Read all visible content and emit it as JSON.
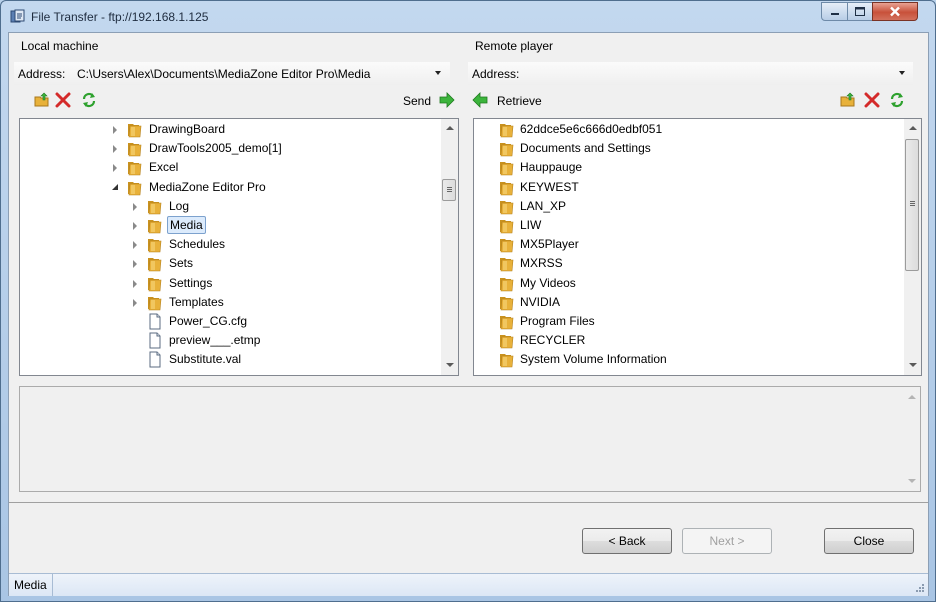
{
  "window": {
    "title": "File Transfer - ftp://192.168.1.125"
  },
  "local": {
    "heading": "Local machine",
    "address_label": "Address:",
    "address_value": "C:\\Users\\Alex\\Documents\\MediaZone Editor Pro\\Media",
    "send_label": "Send",
    "tree": [
      {
        "label": "DrawingBoard",
        "type": "folder",
        "indent": 0,
        "expander": "closed"
      },
      {
        "label": "DrawTools2005_demo[1]",
        "type": "folder",
        "indent": 0,
        "expander": "closed"
      },
      {
        "label": "Excel",
        "type": "folder",
        "indent": 0,
        "expander": "closed"
      },
      {
        "label": "MediaZone Editor Pro",
        "type": "folder",
        "indent": 0,
        "expander": "open"
      },
      {
        "label": "Log",
        "type": "folder",
        "indent": 1,
        "expander": "closed"
      },
      {
        "label": "Media",
        "type": "folder",
        "indent": 1,
        "expander": "closed",
        "selected": true
      },
      {
        "label": "Schedules",
        "type": "folder",
        "indent": 1,
        "expander": "closed"
      },
      {
        "label": "Sets",
        "type": "folder",
        "indent": 1,
        "expander": "closed"
      },
      {
        "label": "Settings",
        "type": "folder",
        "indent": 1,
        "expander": "closed"
      },
      {
        "label": "Templates",
        "type": "folder",
        "indent": 1,
        "expander": "closed"
      },
      {
        "label": "Power_CG.cfg",
        "type": "file",
        "indent": 1,
        "expander": "none"
      },
      {
        "label": "preview___.etmp",
        "type": "file",
        "indent": 1,
        "expander": "none"
      },
      {
        "label": "Substitute.val",
        "type": "file",
        "indent": 1,
        "expander": "none"
      }
    ]
  },
  "remote": {
    "heading": "Remote player",
    "address_label": "Address:",
    "address_value": "",
    "retrieve_label": "Retrieve",
    "tree": [
      {
        "label": "62ddce5e6c666d0edbf051"
      },
      {
        "label": "Documents and Settings"
      },
      {
        "label": "Hauppauge"
      },
      {
        "label": "KEYWEST"
      },
      {
        "label": "LAN_XP"
      },
      {
        "label": "LIW"
      },
      {
        "label": "MX5Player"
      },
      {
        "label": "MXRSS"
      },
      {
        "label": "My Videos"
      },
      {
        "label": "NVIDIA"
      },
      {
        "label": "Program Files"
      },
      {
        "label": "RECYCLER"
      },
      {
        "label": "System Volume Information"
      }
    ]
  },
  "buttons": {
    "back": "< Back",
    "next": "Next >",
    "close": "Close"
  },
  "status": {
    "text": "Media"
  },
  "colors": {
    "folder": "#e8b13a",
    "delete_red": "#d42a2a",
    "refresh_green": "#2ea12e",
    "arrow_green": "#3cb43c"
  }
}
